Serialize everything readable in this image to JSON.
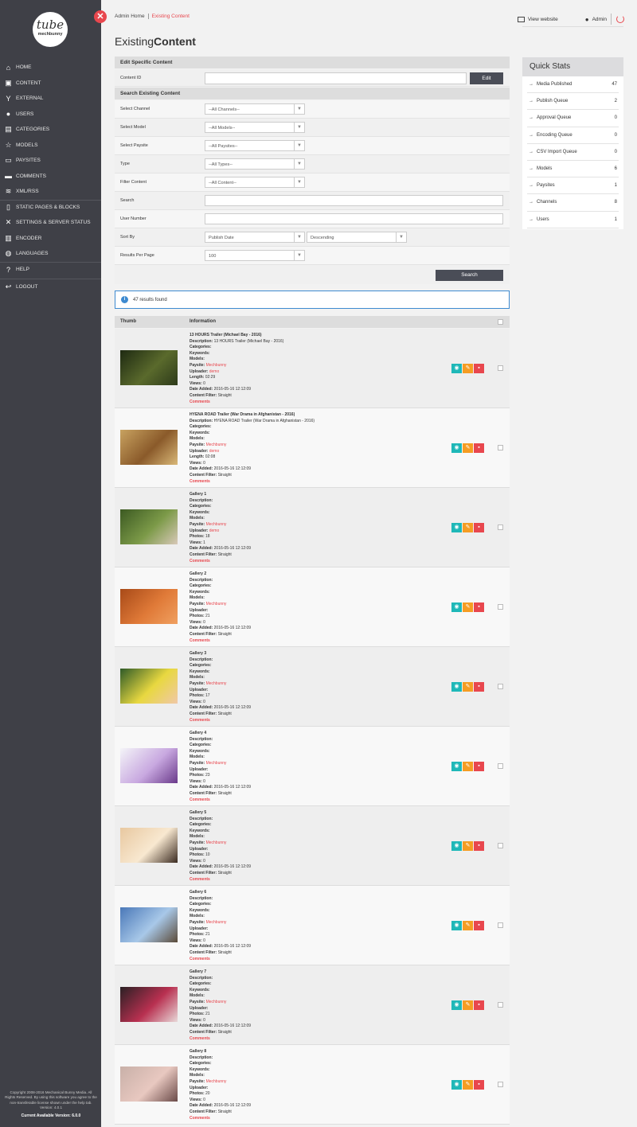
{
  "sidebar": {
    "logo_top": "tube",
    "logo_bottom": "mechbunny",
    "items": [
      {
        "label": "HOME",
        "icon": "home-icon"
      },
      {
        "label": "CONTENT",
        "icon": "cube-icon"
      },
      {
        "label": "EXTERNAL",
        "icon": "fork-icon"
      },
      {
        "label": "USERS",
        "icon": "users-icon"
      },
      {
        "label": "CATEGORIES",
        "icon": "map-icon"
      },
      {
        "label": "MODELS",
        "icon": "star-icon"
      },
      {
        "label": "PAYSITES",
        "icon": "money-icon"
      },
      {
        "label": "COMMENTS",
        "icon": "comments-icon"
      },
      {
        "label": "XML/RSS",
        "icon": "rss-icon"
      },
      {
        "label": "STATIC PAGES & BLOCKS",
        "icon": "file-icon"
      },
      {
        "label": "SETTINGS & SERVER STATUS",
        "icon": "tools-icon"
      },
      {
        "label": "ENCODER",
        "icon": "server-icon"
      },
      {
        "label": "LANGUAGES",
        "icon": "globe-icon"
      },
      {
        "label": "HELP",
        "icon": "question-icon"
      },
      {
        "label": "LOGOUT",
        "icon": "logout-icon"
      }
    ],
    "copyright": "Copyright 2008-2016 Mechanical Bunny Media. All Rights Reserved. By using this software you agree to the non-transferable license shown under the help tab. Version: 4.0.1",
    "current_version": "Current Available Version: 6.0.0"
  },
  "breadcrumb": {
    "home": "Admin Home",
    "current": "Existing Content"
  },
  "topbar": {
    "view_website": "View website",
    "user": "Admin"
  },
  "title": {
    "light": "Existing",
    "bold": "Content"
  },
  "edit_section": {
    "heading": "Edit Specific Content",
    "label": "Content ID",
    "button": "Edit"
  },
  "search_section": {
    "heading": "Search Existing Content",
    "channel": {
      "label": "Select Channel",
      "value": "--All Channels--"
    },
    "model": {
      "label": "Select Model",
      "value": "--All Models--"
    },
    "paysite": {
      "label": "Select Paysite",
      "value": "--All Paysites--"
    },
    "type": {
      "label": "Type",
      "value": "--All Types--"
    },
    "filter": {
      "label": "Filter Content",
      "value": "--All Content--"
    },
    "search": {
      "label": "Search"
    },
    "user_number": {
      "label": "User Number"
    },
    "sort_by": {
      "label": "Sort By",
      "value": "Publish Date",
      "order": "Descending"
    },
    "per_page": {
      "label": "Results Per Page",
      "value": "100"
    },
    "button": "Search"
  },
  "results_text": "47 results found",
  "table": {
    "col_thumb": "Thumb",
    "col_info": "Information"
  },
  "field_labels": {
    "description": "Description:",
    "categories": "Categories:",
    "keywords": "Keywords:",
    "models": "Models:",
    "paysite": "Paysite:",
    "uploader": "Uploader:",
    "length": "Length:",
    "photos": "Photos:",
    "views": "Views:",
    "date_added": "Date Added:",
    "content_filter": "Content Filter:",
    "comments": "Comments"
  },
  "items": [
    {
      "title": "13 HOURS Trailer (Michael Bay - 2016)",
      "description": "13 HOURS Trailer (Michael Bay - 2016)",
      "paysite": "Mechbunny",
      "uploader": "demo",
      "length": "02:29",
      "views": "0",
      "date": "2016-05-16 12:12:09",
      "filter": "Straight",
      "thumb": [
        "#1e2a12",
        "#5a6a2c",
        "#2d3a1a"
      ]
    },
    {
      "title": "HYENA ROAD Trailer (War Drama in Afghanistan - 2016)",
      "description": "HYENA ROAD Trailer (War Drama in Afghanistan - 2016)",
      "paysite": "Mechbunny",
      "uploader": "demo",
      "length": "02:08",
      "views": "0",
      "date": "2016-05-16 12:12:09",
      "filter": "Straight",
      "thumb": [
        "#c8a260",
        "#8a5a2a",
        "#d9b878"
      ]
    },
    {
      "title": "Gallery 1",
      "description": "",
      "paysite": "Mechbunny",
      "uploader": "demo",
      "photos": "18",
      "views": "1",
      "date": "2016-05-16 12:12:09",
      "filter": "Straight",
      "thumb": [
        "#3c5a22",
        "#7c9a48",
        "#d8c8b8"
      ]
    },
    {
      "title": "Gallery 2",
      "description": "",
      "paysite": "Mechbunny",
      "uploader": "",
      "photos": "21",
      "views": "0",
      "date": "2016-05-16 12:12:09",
      "filter": "Straight",
      "thumb": [
        "#a84a18",
        "#e07a38",
        "#f0a060"
      ]
    },
    {
      "title": "Gallery 3",
      "description": "",
      "paysite": "Mechbunny",
      "uploader": "",
      "photos": "17",
      "views": "0",
      "date": "2016-05-16 12:12:09",
      "filter": "Straight",
      "thumb": [
        "#2e5a28",
        "#e8d840",
        "#f0c8a8"
      ]
    },
    {
      "title": "Gallery 4",
      "description": "",
      "paysite": "Mechbunny",
      "uploader": "",
      "photos": "23",
      "views": "0",
      "date": "2016-05-16 12:12:09",
      "filter": "Straight",
      "thumb": [
        "#f4f4f8",
        "#c8a8e0",
        "#6a3a8a"
      ]
    },
    {
      "title": "Gallery 5",
      "description": "",
      "paysite": "Mechbunny",
      "uploader": "",
      "photos": "10",
      "views": "0",
      "date": "2016-05-16 12:12:09",
      "filter": "Straight",
      "thumb": [
        "#e8c8a0",
        "#f8e8d0",
        "#3a2a20"
      ]
    },
    {
      "title": "Gallery 6",
      "description": "",
      "paysite": "Mechbunny",
      "uploader": "",
      "photos": "21",
      "views": "0",
      "date": "2016-05-16 12:12:09",
      "filter": "Straight",
      "thumb": [
        "#4a78b8",
        "#a8c8e8",
        "#5a4a38"
      ]
    },
    {
      "title": "Gallery 7",
      "description": "",
      "paysite": "Mechbunny",
      "uploader": "",
      "photos": "21",
      "views": "0",
      "date": "2016-05-16 12:12:09",
      "filter": "Straight",
      "thumb": [
        "#2a2024",
        "#b83050",
        "#e8d8d8"
      ]
    },
    {
      "title": "Gallery 8",
      "description": "",
      "paysite": "Mechbunny",
      "uploader": "",
      "photos": "20",
      "views": "0",
      "date": "2016-05-16 12:12:09",
      "filter": "Straight",
      "thumb": [
        "#c8b0a8",
        "#e8c8c0",
        "#6a4a48"
      ]
    }
  ],
  "quick_stats": {
    "title": "Quick Stats",
    "rows": [
      {
        "label": "Media Published",
        "value": "47"
      },
      {
        "label": "Publish Queue",
        "value": "2"
      },
      {
        "label": "Approval Queue",
        "value": "0"
      },
      {
        "label": "Encoding Queue",
        "value": "0"
      },
      {
        "label": "CSV Import Queue",
        "value": "0"
      },
      {
        "label": "Models",
        "value": "6"
      },
      {
        "label": "Paysites",
        "value": "1"
      },
      {
        "label": "Channels",
        "value": "8"
      },
      {
        "label": "Users",
        "value": "1"
      }
    ]
  },
  "colors": {
    "accent": "#e8474e",
    "sidebar": "#3f4047",
    "view": "#1fb8b8",
    "edit": "#f59d23",
    "delete": "#e8474e",
    "info": "#3d8ad0"
  }
}
